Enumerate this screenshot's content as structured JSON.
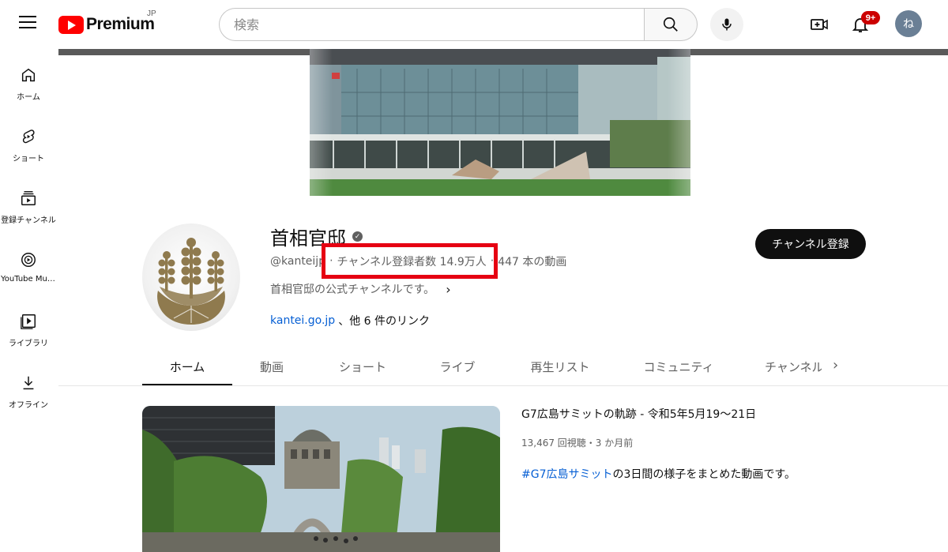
{
  "header": {
    "logo_text": "Premium",
    "logo_region": "JP",
    "search_placeholder": "検索",
    "notification_badge": "9+",
    "avatar_initial": "ね"
  },
  "sidebar": {
    "items": [
      {
        "label": "ホーム",
        "icon": "home-icon"
      },
      {
        "label": "ショート",
        "icon": "shorts-icon"
      },
      {
        "label": "登録チャンネル",
        "icon": "subscriptions-icon"
      },
      {
        "label": "YouTube Music",
        "icon": "youtube-music-icon"
      },
      {
        "label": "ライブラリ",
        "icon": "library-icon"
      },
      {
        "label": "オフライン",
        "icon": "download-icon"
      }
    ]
  },
  "channel": {
    "name": "首相官邸",
    "handle": "@kanteijp",
    "subscribers": "チャンネル登録者数 14.9万人",
    "video_count": "447 本の動画",
    "description": "首相官邸の公式チャンネルです。",
    "link_text": "kantei.go.jp",
    "link_more": "、他 6 件のリンク",
    "subscribe_label": "チャンネル登録"
  },
  "tabs": [
    {
      "label": "ホーム",
      "active": true
    },
    {
      "label": "動画",
      "active": false
    },
    {
      "label": "ショート",
      "active": false
    },
    {
      "label": "ライブ",
      "active": false
    },
    {
      "label": "再生リスト",
      "active": false
    },
    {
      "label": "コミュニティ",
      "active": false
    },
    {
      "label": "チャンネル",
      "active": false
    }
  ],
  "featured_video": {
    "title": "G7広島サミットの軌跡 - 令和5年5月19～21日",
    "meta": "13,467 回視聴・3 か月前",
    "hashtag": "#G7広島サミット",
    "description_rest": "の3日間の様子をまとめた動画です。"
  },
  "colors": {
    "brand_red": "#ff0000",
    "highlight_box": "#e60012",
    "link_blue": "#065fd4",
    "subscribe_bg": "#0f0f0f"
  }
}
